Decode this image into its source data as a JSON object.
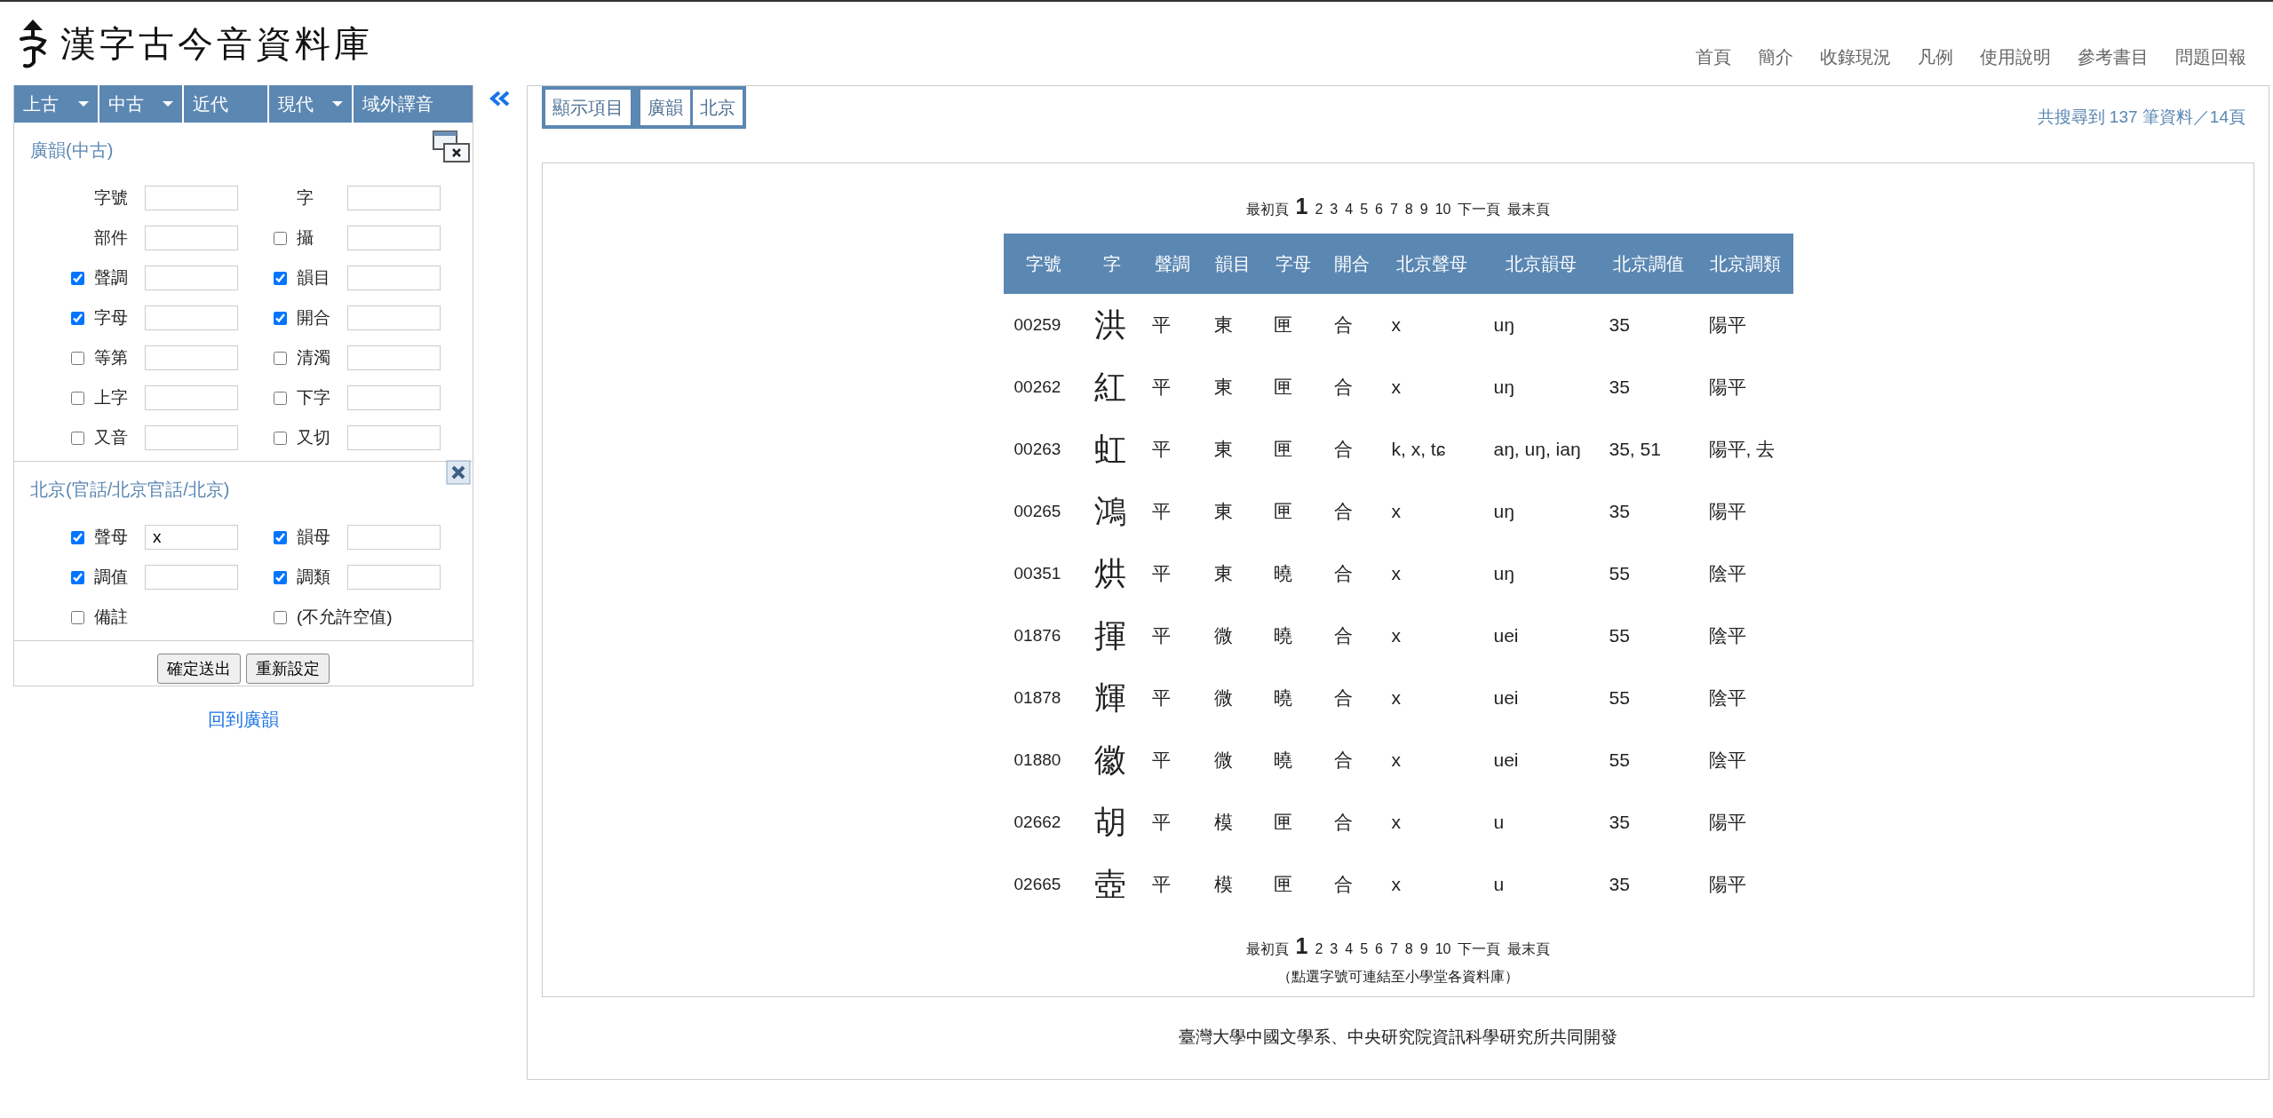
{
  "header": {
    "title": "漢字古今音資料庫",
    "nav": [
      "首頁",
      "簡介",
      "收錄現況",
      "凡例",
      "使用說明",
      "參考書目",
      "問題回報"
    ]
  },
  "sidebar": {
    "period_tabs": [
      {
        "label": "上古",
        "dropdown": true
      },
      {
        "label": "中古",
        "dropdown": true
      },
      {
        "label": "近代",
        "dropdown": false
      },
      {
        "label": "現代",
        "dropdown": true
      },
      {
        "label": "域外譯音",
        "dropdown": false
      }
    ],
    "sections": [
      {
        "title": "廣韻(中古)",
        "kind": "group",
        "fields": [
          {
            "kind": "plain",
            "label": "字號"
          },
          {
            "kind": "plain",
            "label": "字"
          },
          {
            "kind": "plain",
            "label": "部件"
          },
          {
            "kind": "check",
            "label": "攝",
            "checked": false
          },
          {
            "kind": "check",
            "label": "聲調",
            "checked": true
          },
          {
            "kind": "check",
            "label": "韻目",
            "checked": true
          },
          {
            "kind": "check",
            "label": "字母",
            "checked": true
          },
          {
            "kind": "check",
            "label": "開合",
            "checked": true
          },
          {
            "kind": "check",
            "label": "等第",
            "checked": false
          },
          {
            "kind": "check",
            "label": "清濁",
            "checked": false
          },
          {
            "kind": "check",
            "label": "上字",
            "checked": false
          },
          {
            "kind": "check",
            "label": "下字",
            "checked": false
          },
          {
            "kind": "check",
            "label": "又音",
            "checked": false
          },
          {
            "kind": "check",
            "label": "又切",
            "checked": false
          }
        ]
      },
      {
        "title": "北京(官話/北京官話/北京)",
        "kind": "removable",
        "fields": [
          {
            "kind": "check",
            "label": "聲母",
            "checked": true,
            "value": "x"
          },
          {
            "kind": "check",
            "label": "韻母",
            "checked": true
          },
          {
            "kind": "check",
            "label": "調值",
            "checked": true
          },
          {
            "kind": "check",
            "label": "調類",
            "checked": true
          },
          {
            "kind": "check_only",
            "label": "備註",
            "checked": false
          },
          {
            "kind": "check_only",
            "label": "(不允許空值)",
            "checked": false
          }
        ]
      }
    ],
    "buttons": [
      "確定送出",
      "重新設定"
    ],
    "back_link": "回到廣韻"
  },
  "results": {
    "display_button": "顯示項目",
    "display_tabs": [
      "廣韻",
      "北京"
    ],
    "summary": "共搜尋到 137 筆資料／14頁",
    "pagination_top": {
      "first": "最初頁",
      "pages": [
        {
          "label": "1",
          "selected": true
        },
        {
          "label": "2",
          "selected": false
        },
        {
          "label": "3",
          "selected": false
        },
        {
          "label": "4",
          "selected": false
        },
        {
          "label": "5",
          "selected": false
        },
        {
          "label": "6",
          "selected": false
        },
        {
          "label": "7",
          "selected": false
        },
        {
          "label": "8",
          "selected": false
        },
        {
          "label": "9",
          "selected": false
        },
        {
          "label": "10",
          "selected": false
        }
      ],
      "next": "下一頁",
      "last": "最末頁"
    },
    "table": {
      "columns": [
        "字號",
        "字",
        "聲調",
        "韻目",
        "字母",
        "開合",
        "北京聲母",
        "北京韻母",
        "北京調值",
        "北京調類"
      ],
      "rows": [
        [
          "00259",
          "洪",
          "平",
          "東",
          "匣",
          "合",
          "x",
          "uŋ",
          "35",
          "陽平"
        ],
        [
          "00262",
          "紅",
          "平",
          "東",
          "匣",
          "合",
          "x",
          "uŋ",
          "35",
          "陽平"
        ],
        [
          "00263",
          "虹",
          "平",
          "東",
          "匣",
          "合",
          "k, x, tɕ",
          "aŋ, uŋ, iaŋ",
          "35, 51",
          "陽平, 去"
        ],
        [
          "00265",
          "鴻",
          "平",
          "東",
          "匣",
          "合",
          "x",
          "uŋ",
          "35",
          "陽平"
        ],
        [
          "00351",
          "烘",
          "平",
          "東",
          "曉",
          "合",
          "x",
          "uŋ",
          "55",
          "陰平"
        ],
        [
          "01876",
          "揮",
          "平",
          "微",
          "曉",
          "合",
          "x",
          "uei",
          "55",
          "陰平"
        ],
        [
          "01878",
          "輝",
          "平",
          "微",
          "曉",
          "合",
          "x",
          "uei",
          "55",
          "陰平"
        ],
        [
          "01880",
          "徽",
          "平",
          "微",
          "曉",
          "合",
          "x",
          "uei",
          "55",
          "陰平"
        ],
        [
          "02662",
          "胡",
          "平",
          "模",
          "匣",
          "合",
          "x",
          "u",
          "35",
          "陽平"
        ],
        [
          "02665",
          "壺",
          "平",
          "模",
          "匣",
          "合",
          "x",
          "u",
          "35",
          "陽平"
        ]
      ]
    },
    "pagination_bottom": {
      "first": "最初頁",
      "pages": [
        {
          "label": "1",
          "selected": true
        },
        {
          "label": "2",
          "selected": false
        },
        {
          "label": "3",
          "selected": false
        },
        {
          "label": "4",
          "selected": false
        },
        {
          "label": "5",
          "selected": false
        },
        {
          "label": "6",
          "selected": false
        },
        {
          "label": "7",
          "selected": false
        },
        {
          "label": "8",
          "selected": false
        },
        {
          "label": "9",
          "selected": false
        },
        {
          "label": "10",
          "selected": false
        }
      ],
      "next": "下一頁",
      "last": "最末頁"
    },
    "note": "（點選字號可連結至小學堂各資料庫）"
  },
  "footer": "臺灣大學中國文學系、中央研究院資訊科學研究所共同開發"
}
